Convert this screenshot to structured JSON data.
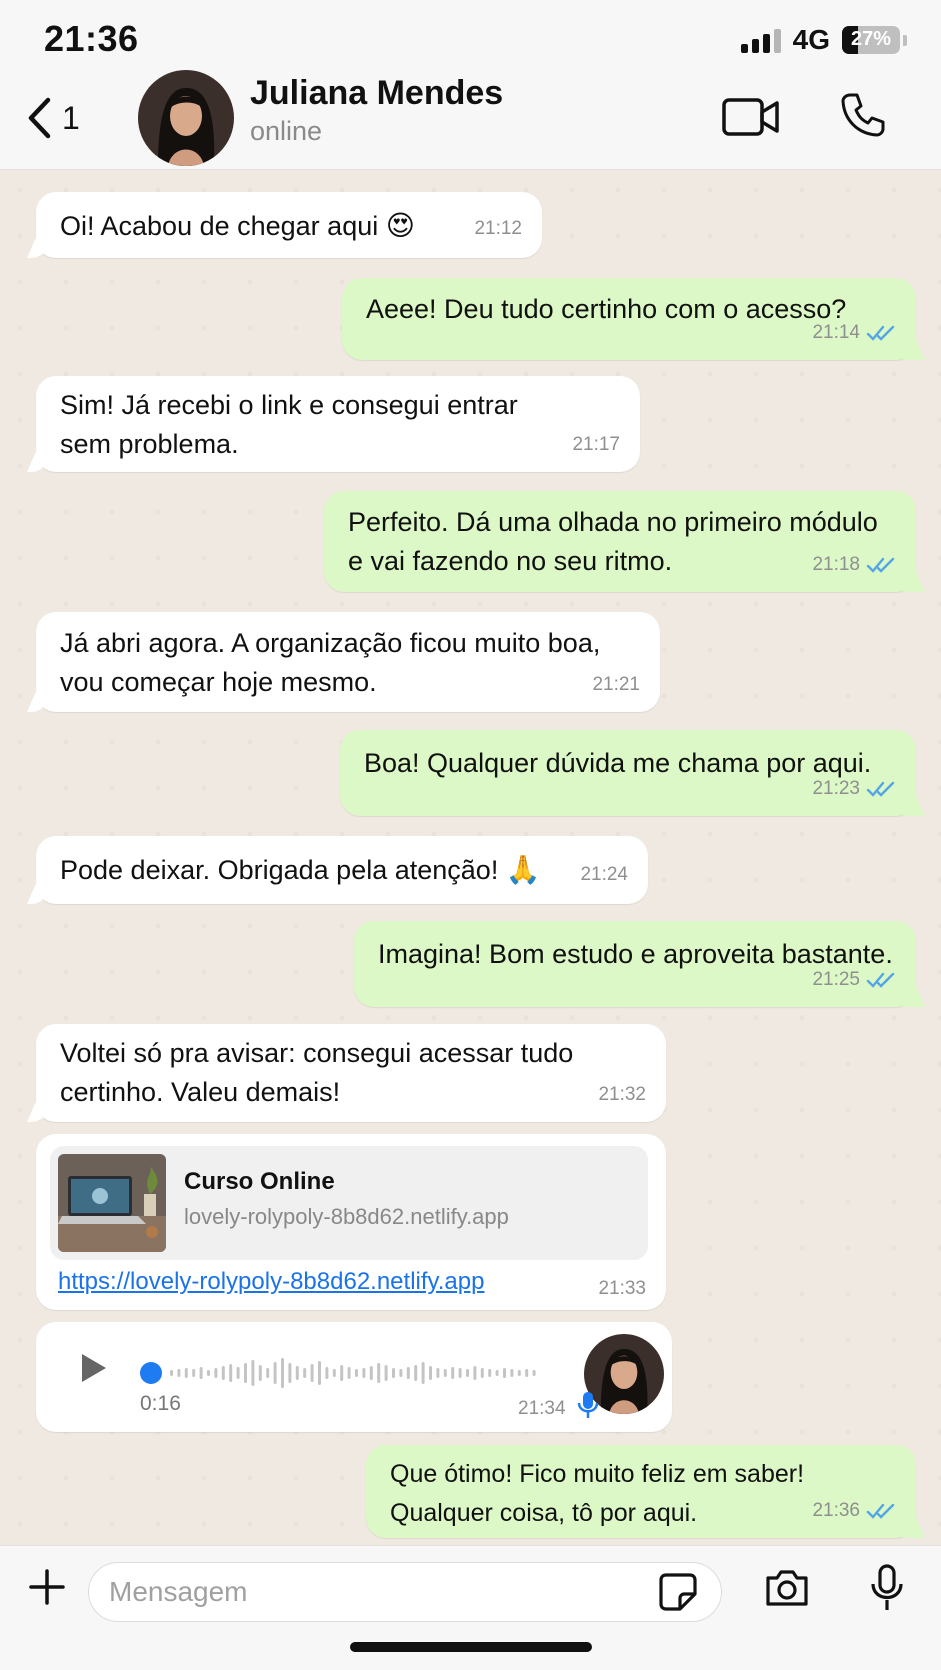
{
  "status_bar": {
    "time": "21:36",
    "network": "4G",
    "battery": "27%",
    "battery_level": 0.27
  },
  "header": {
    "back_count": "1",
    "contact_name": "Juliana Mendes",
    "contact_status": "online"
  },
  "messages": [
    {
      "direction": "in",
      "text": "Oi! Acabou de chegar aqui",
      "emoji": "😍",
      "time": "21:12"
    },
    {
      "direction": "out",
      "text": "Aeee! Deu tudo certinho com o acesso?",
      "time": "21:14",
      "read": true
    },
    {
      "direction": "in",
      "line1": "Sim! Já recebi o link e consegui entrar",
      "line2": "sem problema.",
      "time": "21:17"
    },
    {
      "direction": "out",
      "line1": "Perfeito. Dá uma olhada no primeiro módulo",
      "line2": "e vai fazendo no seu ritmo.",
      "time": "21:18",
      "read": true
    },
    {
      "direction": "in",
      "line1": "Já abri agora. A organização ficou muito boa,",
      "line2": "vou começar hoje mesmo.",
      "time": "21:21"
    },
    {
      "direction": "out",
      "text": "Boa! Qualquer dúvida me chama por aqui.",
      "time": "21:23",
      "read": true
    },
    {
      "direction": "in",
      "text": "Pode deixar. Obrigada pela atenção!",
      "emoji": "🙏",
      "time": "21:24"
    },
    {
      "direction": "out",
      "text": "Imagina! Bom estudo e aproveita bastante.",
      "time": "21:25",
      "read": true
    },
    {
      "direction": "in",
      "line1": "Voltei só pra avisar: consegui acessar tudo",
      "line2": "certinho. Valeu demais!",
      "time": "21:32"
    },
    {
      "direction": "out",
      "line1": "Que ótimo! Fico muito feliz em saber!",
      "line2": "Qualquer coisa, tô por aqui.",
      "time": "21:36",
      "read": true
    }
  ],
  "link_message": {
    "title": "Curso Online",
    "domain": "lovely-rolypoly-8b8d62.netlify.app",
    "url": "https://lovely-rolypoly-8b8d62.netlify.app",
    "time": "21:33"
  },
  "audio_message": {
    "duration": "0:16",
    "time": "21:34",
    "progress": 0
  },
  "input": {
    "placeholder": "Mensagem",
    "value": ""
  },
  "icons": {
    "back": "chevron-left-icon",
    "video": "video-camera-icon",
    "call": "phone-icon",
    "plus": "plus-icon",
    "sticker": "sticker-icon",
    "camera": "camera-icon",
    "mic": "microphone-icon",
    "read_receipt": "double-check-icon",
    "play": "play-icon"
  },
  "colors": {
    "incoming_bubble": "#ffffff",
    "outgoing_bubble": "#dcf8c6",
    "read_tick": "#53a6e6",
    "link": "#1a73e8",
    "audio_accent": "#1e7bf2"
  }
}
